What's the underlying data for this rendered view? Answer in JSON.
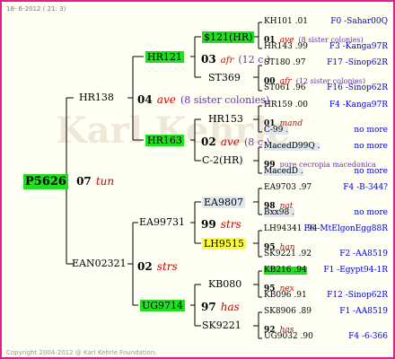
{
  "meta": {
    "date": "18- 6-2012 ( 21: 3)",
    "copyright": "Copyright 2004-2012 @ Karl Kehrle Foundation."
  },
  "root": {
    "name": "P5626",
    "year": "07",
    "grade": "tun"
  },
  "gen1": [
    {
      "name": "HR138",
      "year": "04",
      "grade": "ave",
      "note": "(8 sister colonies)"
    },
    {
      "name": "EAN02321",
      "year": "02",
      "grade": "strs",
      "note": ""
    }
  ],
  "gen2": [
    {
      "name": "HR121",
      "year": "03",
      "grade": "afr",
      "note": "(12 c.)"
    },
    {
      "name": "HR163",
      "year": "02",
      "grade": "ave",
      "note": "(8 c.)"
    },
    {
      "name": "EA99731",
      "year": "99",
      "grade": "strs",
      "note": ""
    },
    {
      "name": "UG9714",
      "year": "97",
      "grade": "has",
      "note": ""
    }
  ],
  "gen3": [
    {
      "name": "$121(HR)"
    },
    {
      "name": "ST369"
    },
    {
      "name": "HR153"
    },
    {
      "name": "C-2(HR)"
    },
    {
      "name": "EA9807"
    },
    {
      "name": "LH9515"
    },
    {
      "name": "KB080"
    },
    {
      "name": "SK9221"
    }
  ],
  "gen4": [
    {
      "l1": "KH101 .01",
      "r1": "F0 -Sahar00Q",
      "y": "01",
      "q": "ave",
      "s": "(8 sister colonies)",
      "l2": "HR143 .99",
      "r2": "F3 -Kanga97R"
    },
    {
      "l1": "ST180 .97",
      "r1": "F17 -Sinop62R",
      "y": "00",
      "q": "afr",
      "s": "(12 sister colonies)",
      "l2": "ST061 .96",
      "r2": "F16 -Sinop62R"
    },
    {
      "l1": "HR159 .00",
      "r1": "F4 -Kanga97R",
      "y": "01",
      "q": "mand",
      "s": "",
      "l2": "C-99 .",
      "r2": "no more"
    },
    {
      "l1": "MacedD99Q .",
      "r1": "no more",
      "y": "99",
      "q": "",
      "s": "pure cecropia macedonica",
      "l2": "MacedD .",
      "r2": "no more"
    },
    {
      "l1": "EA9703 .97",
      "r1": "F4 -B-344?",
      "y": "98",
      "q": "nat",
      "s": "",
      "l2": "Bxx98 .",
      "r2": "no more"
    },
    {
      "l1": "LH94341 .94",
      "r1": "F6 -MtElgonEgg88R",
      "y": "95",
      "q": "han",
      "s": "",
      "l2": "SK9221 .92",
      "r2": "F2 -AA8519"
    },
    {
      "l1": "KB216 .94",
      "r1": "F1 -Egypt94-1R",
      "y": "95",
      "q": "nex",
      "s": "",
      "l2": "KB096 .91",
      "r2": "F12 -Sinop62R"
    },
    {
      "l1": "SK8906 .89",
      "r1": "F1 -AA8519",
      "y": "92",
      "q": "has",
      "s": "",
      "l2": "UG9032 .90",
      "r2": "F4 -6-366"
    }
  ]
}
